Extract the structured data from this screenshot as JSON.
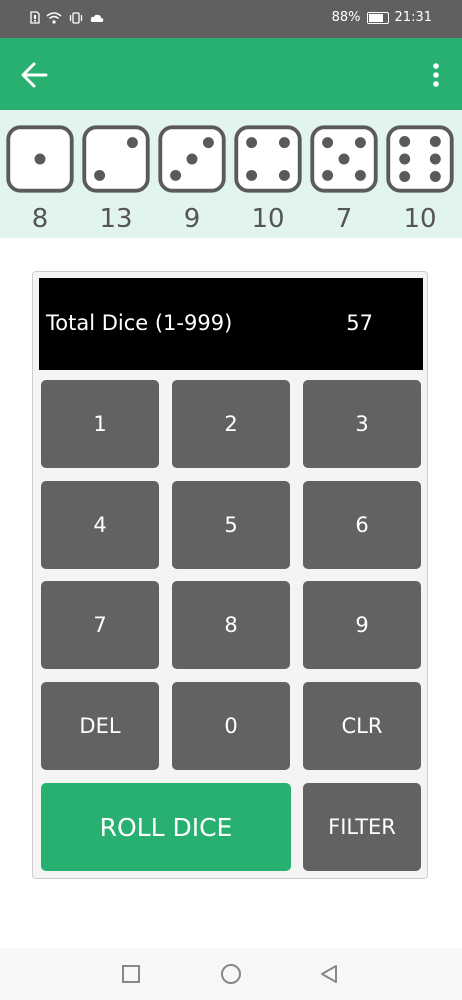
{
  "status_bar": {
    "battery": "88%",
    "time": "21:31",
    "battery_level": 0.88
  },
  "icons": {
    "back": "back-arrow-icon",
    "menu": "more-vertical-icon",
    "nav_back": "triangle-back-icon",
    "nav_home": "circle-home-icon",
    "nav_recent": "square-recents-icon"
  },
  "colors": {
    "accent": "#27b070",
    "key": "#626262",
    "display": "#000000",
    "dice_strip": "#e2f5ec",
    "status_bar": "#606060"
  },
  "dice": [
    {
      "face": 1,
      "count": "8"
    },
    {
      "face": 2,
      "count": "13"
    },
    {
      "face": 3,
      "count": "9"
    },
    {
      "face": 4,
      "count": "10"
    },
    {
      "face": 5,
      "count": "7"
    },
    {
      "face": 6,
      "count": "10"
    }
  ],
  "display": {
    "label": "Total Dice (1-999)",
    "value": "57"
  },
  "keys": {
    "k1": "1",
    "k2": "2",
    "k3": "3",
    "k4": "4",
    "k5": "5",
    "k6": "6",
    "k7": "7",
    "k8": "8",
    "k9": "9",
    "del": "DEL",
    "k0": "0",
    "clr": "CLR",
    "roll": "ROLL DICE",
    "filter": "FILTER"
  }
}
